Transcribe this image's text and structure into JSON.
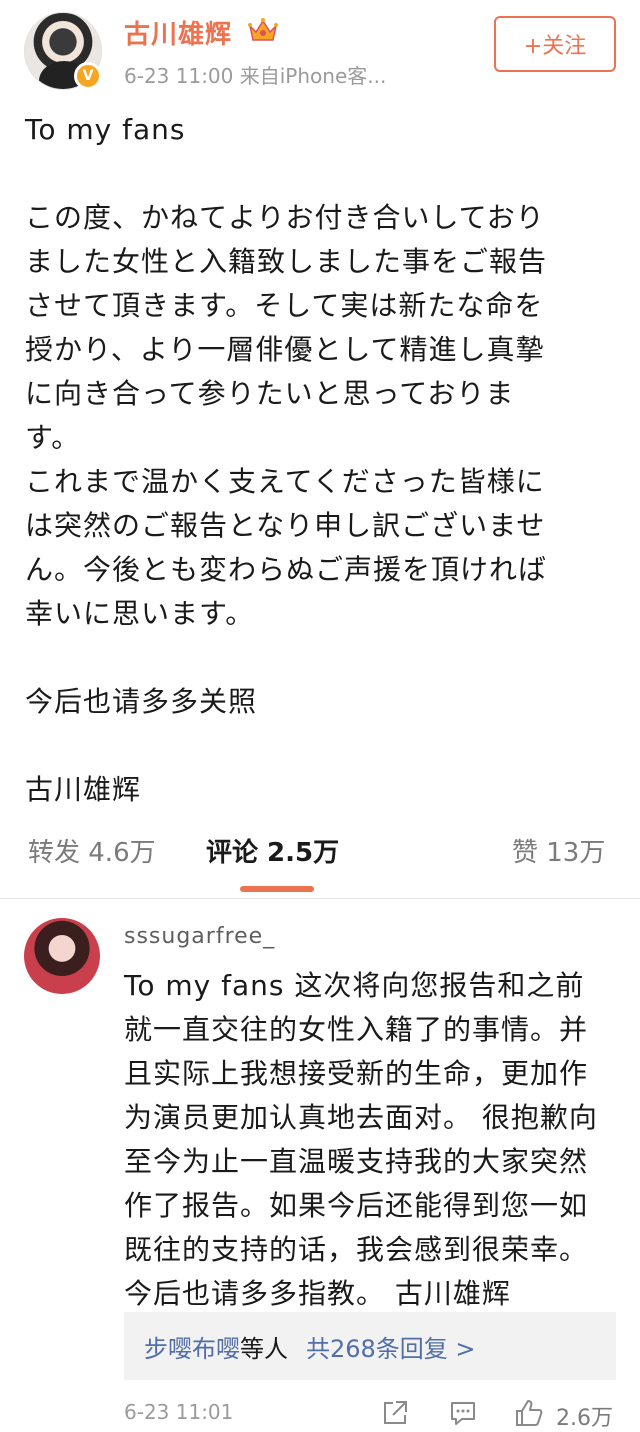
{
  "post": {
    "author": "古川雄辉",
    "meta": "6-23 11:00   来自iPhone客...",
    "follow_label": "+关注",
    "verified_mark": "V",
    "lines": [
      "To my fans",
      "",
      "この度、かねてよりお付き合いしており",
      "ました女性と入籍致しました事をご報告",
      "させて頂きます。そして実は新たな命を",
      "授かり、より一層俳優として精進し真摯",
      "に向き合って参りたいと思っておりま",
      "す。",
      "これまで温かく支えてくださった皆様に",
      "は突然のご報告となり申し訳ございませ",
      "ん。今後とも変わらぬご声援を頂ければ",
      "幸いに思います。",
      "",
      "今后也请多多关照",
      "",
      "古川雄辉"
    ]
  },
  "tabs": {
    "repost": "转发 4.6万",
    "comment": "评论 2.5万",
    "like": "赞 13万"
  },
  "comment": {
    "username": "sssugarfree_",
    "lines": [
      "To my fans  这次将向您报告和之前",
      "就一直交往的女性入籍了的事情。并",
      "且实际上我想接受新的生命，更加作",
      "为演员更加认真地去面对。 很抱歉向",
      "至今为止一直温暖支持我的大家突然",
      "作了报告。如果今后还能得到您一如",
      "既往的支持的话，我会感到很荣幸。",
      "今后也请多多指教。  古川雄辉"
    ],
    "reply_names": "步嘤布嘤",
    "reply_suffix": "等人",
    "reply_count": "共268条回复 >",
    "time": "6-23 11:01",
    "like_count": "2.6万"
  },
  "colors": {
    "accent": "#eb7350",
    "link": "#526ea6",
    "muted": "#9b9b9b"
  },
  "icons": [
    "crown-icon",
    "verified-icon",
    "share-icon",
    "reply-icon",
    "like-icon"
  ]
}
